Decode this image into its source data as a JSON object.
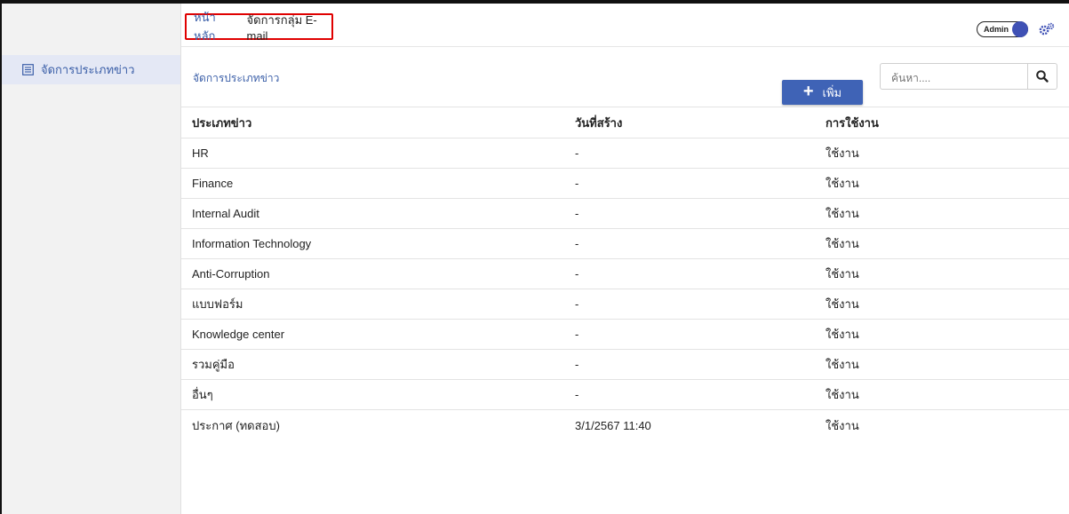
{
  "breadcrumb": {
    "home": "หน้าหลัก",
    "current": "จัดการกลุ่ม E-mail"
  },
  "header": {
    "role_label": "Admin",
    "accent_color": "#3f51b5",
    "settings_icon": "gears-icon"
  },
  "sidebar": {
    "items": [
      {
        "label": "จัดการประเภทข่าว",
        "icon": "list-icon",
        "active": true
      }
    ]
  },
  "main": {
    "section_title": "จัดการประเภทข่าว",
    "add_button_label": "เพิ่ม",
    "search": {
      "placeholder": "ค้นหา....",
      "value": ""
    },
    "table": {
      "columns": [
        "ประเภทข่าว",
        "วันที่สร้าง",
        "การใช้งาน"
      ],
      "rows": [
        [
          "HR",
          "-",
          "ใช้งาน"
        ],
        [
          "Finance",
          "-",
          "ใช้งาน"
        ],
        [
          "Internal Audit",
          "-",
          "ใช้งาน"
        ],
        [
          "Information Technology",
          "-",
          "ใช้งาน"
        ],
        [
          "Anti-Corruption",
          "-",
          "ใช้งาน"
        ],
        [
          "แบบฟอร์ม",
          "-",
          "ใช้งาน"
        ],
        [
          "Knowledge center",
          "-",
          "ใช้งาน"
        ],
        [
          "รวมคู่มือ",
          "-",
          "ใช้งาน"
        ],
        [
          "อื่นๆ",
          "-",
          "ใช้งาน"
        ],
        [
          "ประกาศ (ทดสอบ)",
          "3/1/2567 11:40",
          "ใช้งาน"
        ]
      ]
    }
  }
}
